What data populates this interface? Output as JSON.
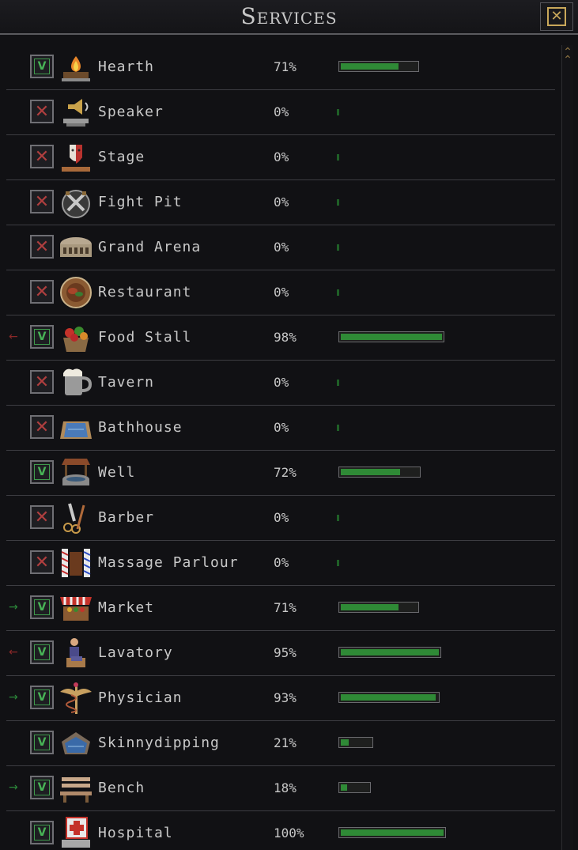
{
  "window": {
    "title": "Services",
    "close_icon": "close-icon"
  },
  "colors": {
    "enabled": "#48b356",
    "disabled": "#b03f3f",
    "bar_fill": "#2f8a36",
    "arrow_in": "#2c8a3a",
    "arrow_out": "#8a2828"
  },
  "services": [
    {
      "name": "Hearth",
      "icon": "hearth-icon",
      "enabled": true,
      "percent": "71%",
      "value": 0.71,
      "arrow": ""
    },
    {
      "name": "Speaker",
      "icon": "speaker-icon",
      "enabled": false,
      "percent": "0%",
      "value": 0,
      "arrow": ""
    },
    {
      "name": "Stage",
      "icon": "stage-icon",
      "enabled": false,
      "percent": "0%",
      "value": 0,
      "arrow": ""
    },
    {
      "name": "Fight Pit",
      "icon": "fight-pit-icon",
      "enabled": false,
      "percent": "0%",
      "value": 0,
      "arrow": ""
    },
    {
      "name": "Grand Arena",
      "icon": "grand-arena-icon",
      "enabled": false,
      "percent": "0%",
      "value": 0,
      "arrow": ""
    },
    {
      "name": "Restaurant",
      "icon": "restaurant-icon",
      "enabled": false,
      "percent": "0%",
      "value": 0,
      "arrow": ""
    },
    {
      "name": "Food Stall",
      "icon": "food-stall-icon",
      "enabled": true,
      "percent": "98%",
      "value": 0.98,
      "arrow": "out"
    },
    {
      "name": "Tavern",
      "icon": "tavern-icon",
      "enabled": false,
      "percent": "0%",
      "value": 0,
      "arrow": ""
    },
    {
      "name": "Bathhouse",
      "icon": "bathhouse-icon",
      "enabled": false,
      "percent": "0%",
      "value": 0,
      "arrow": ""
    },
    {
      "name": "Well",
      "icon": "well-icon",
      "enabled": true,
      "percent": "72%",
      "value": 0.72,
      "arrow": ""
    },
    {
      "name": "Barber",
      "icon": "barber-icon",
      "enabled": false,
      "percent": "0%",
      "value": 0,
      "arrow": ""
    },
    {
      "name": "Massage Parlour",
      "icon": "massage-parlour-icon",
      "enabled": false,
      "percent": "0%",
      "value": 0,
      "arrow": ""
    },
    {
      "name": "Market",
      "icon": "market-icon",
      "enabled": true,
      "percent": "71%",
      "value": 0.71,
      "arrow": "in"
    },
    {
      "name": "Lavatory",
      "icon": "lavatory-icon",
      "enabled": true,
      "percent": "95%",
      "value": 0.95,
      "arrow": "out"
    },
    {
      "name": "Physician",
      "icon": "physician-icon",
      "enabled": true,
      "percent": "93%",
      "value": 0.93,
      "arrow": "in"
    },
    {
      "name": "Skinnydipping",
      "icon": "skinnydipping-icon",
      "enabled": true,
      "percent": "21%",
      "value": 0.21,
      "arrow": ""
    },
    {
      "name": "Bench",
      "icon": "bench-icon",
      "enabled": true,
      "percent": "18%",
      "value": 0.18,
      "arrow": "in"
    },
    {
      "name": "Hospital",
      "icon": "hospital-icon",
      "enabled": true,
      "percent": "100%",
      "value": 1.0,
      "arrow": ""
    }
  ]
}
